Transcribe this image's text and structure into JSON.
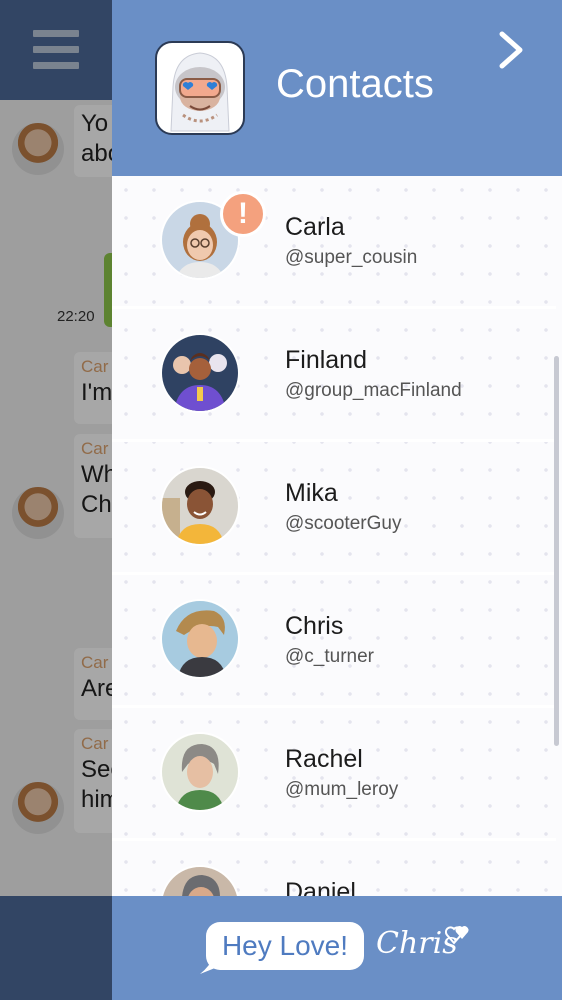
{
  "background_chat": {
    "messages": [
      {
        "text": "Yo",
        "text2": "abo"
      },
      {
        "text": "Car",
        "text2": "I'm"
      },
      {
        "text": "Car",
        "text2": "Wh",
        "text3": "Ch"
      },
      {
        "text": "Car",
        "text2": "Are"
      },
      {
        "text": "Car",
        "text2": "See",
        "text3": "him"
      }
    ],
    "time": "22:20"
  },
  "header": {
    "title": "Contacts",
    "next_icon": "chevron-right-icon"
  },
  "contacts": [
    {
      "name": "Carla",
      "handle": "@super_cousin",
      "alert": "!"
    },
    {
      "name": "Finland",
      "handle": "@group_macFinland"
    },
    {
      "name": "Mika",
      "handle": "@scooterGuy"
    },
    {
      "name": "Chris",
      "handle": "@c_turner"
    },
    {
      "name": "Rachel",
      "handle": "@mum_leroy"
    },
    {
      "name": "Daniel",
      "handle": ""
    }
  ],
  "footer": {
    "logo_text": "Hey Love!",
    "logo_signature": "Chris"
  },
  "colors": {
    "header": "#6a8fc6",
    "alert": "#f4a17e",
    "logo_text": "#4f7bc0"
  }
}
